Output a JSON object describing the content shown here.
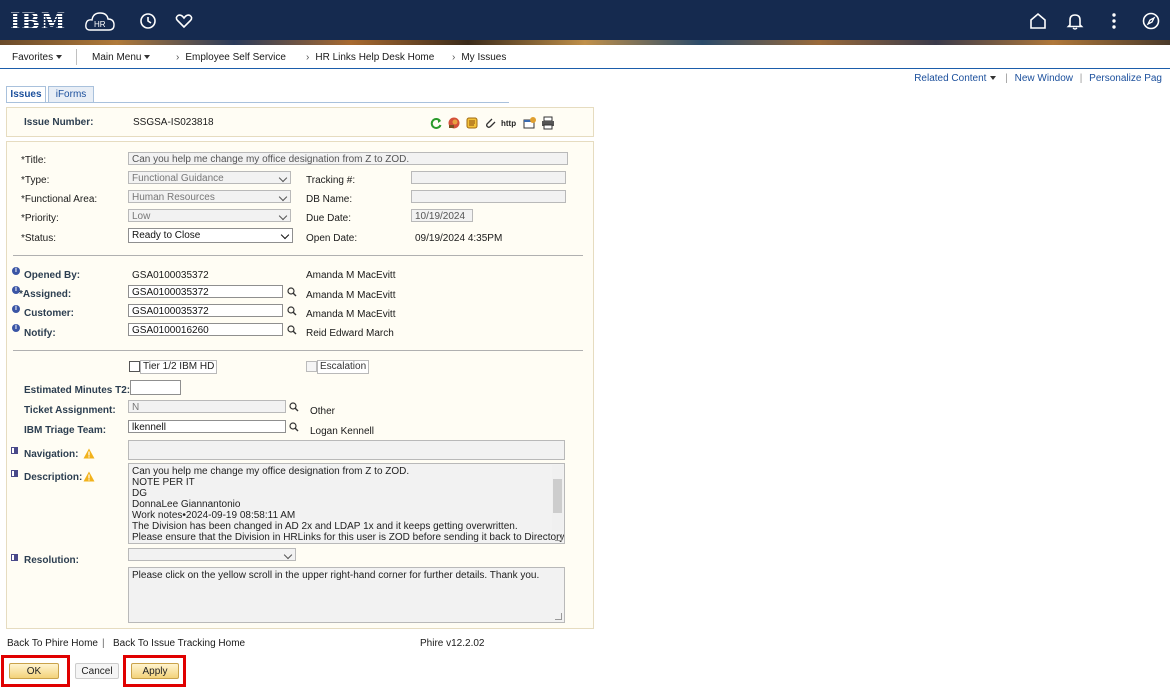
{
  "header": {
    "logo": "IBM",
    "hr_badge": "HR",
    "icons": [
      "clock-icon",
      "heart-icon",
      "home-icon",
      "bell-icon",
      "more-vertical-icon",
      "compass-icon"
    ]
  },
  "navbar": {
    "favorites": "Favorites",
    "main_menu": "Main Menu",
    "breadcrumbs": [
      "Employee Self Service",
      "HR Links Help Desk Home",
      "My Issues"
    ]
  },
  "related": {
    "related_content": "Related Content",
    "new_window": "New Window",
    "personalize": "Personalize Pag"
  },
  "tabs": [
    "Issues",
    "iForms"
  ],
  "issue": {
    "number_label": "Issue Number:",
    "number": "SSGSA-IS023818"
  },
  "form": {
    "title_label": "*Title:",
    "title_value": "Can you help me change my office designation from Z to ZOD.",
    "type_label": "*Type:",
    "type_value": "Functional Guidance",
    "functional_area_label": "*Functional Area:",
    "functional_area_value": "Human Resources",
    "priority_label": "*Priority:",
    "priority_value": "Low",
    "status_label": "*Status:",
    "status_value": "Ready to Close",
    "tracking_label": "Tracking #:",
    "tracking_value": "",
    "db_name_label": "DB Name:",
    "db_name_value": "",
    "due_date_label": "Due Date:",
    "due_date_value": "10/19/2024",
    "open_date_label": "Open Date:",
    "open_date_value": "09/19/2024  4:35PM",
    "opened_by_label": "Opened By:",
    "opened_by_id": "GSA0100035372",
    "opened_by_name": "Amanda M MacEvitt",
    "assigned_label": "*Assigned:",
    "assigned_id": "GSA0100035372",
    "assigned_name": "Amanda M MacEvitt",
    "customer_label": "Customer:",
    "customer_id": "GSA0100035372",
    "customer_name": "Amanda M MacEvitt",
    "notify_label": "Notify:",
    "notify_id": "GSA0100016260",
    "notify_name": "Reid Edward March",
    "tier_label": "Tier 1/2 IBM HD",
    "escalation_label": "Escalation",
    "est_minutes_label": "Estimated Minutes T2:",
    "est_minutes_value": "",
    "ticket_assignment_label": "Ticket Assignment:",
    "ticket_assignment_value": "N",
    "ticket_assignment_desc": "Other",
    "triage_label": "IBM Triage Team:",
    "triage_value": "lkennell",
    "triage_desc": "Logan Kennell",
    "navigation_label": "Navigation:",
    "navigation_value": "",
    "description_label": "Description:",
    "description_lines": [
      "Can you help me change my office designation from Z to ZOD.",
      "NOTE PER IT",
      "DG",
      "DonnaLee Giannantonio",
      "Work notes•2024-09-19 08:58:11 AM",
      "The Division has been changed in AD 2x and LDAP 1x and it keeps getting overwritten.",
      "Please ensure that the Division in HRLinks for this user is ZOD before sending it back to Directory"
    ],
    "resolution_label": "Resolution:",
    "resolution_select": "",
    "resolution_text": "Please click on the yellow scroll in the upper right-hand corner for further details. Thank you."
  },
  "footer": {
    "back_phire": "Back To Phire Home",
    "divider": "|",
    "back_issue": "Back To Issue Tracking Home",
    "version": "Phire v12.2.02"
  },
  "buttons": {
    "ok": "OK",
    "cancel": "Cancel",
    "apply": "Apply"
  },
  "colors": {
    "header_bg": "#152a4f",
    "highlight": "#e00000",
    "button": "#f3d27a"
  }
}
